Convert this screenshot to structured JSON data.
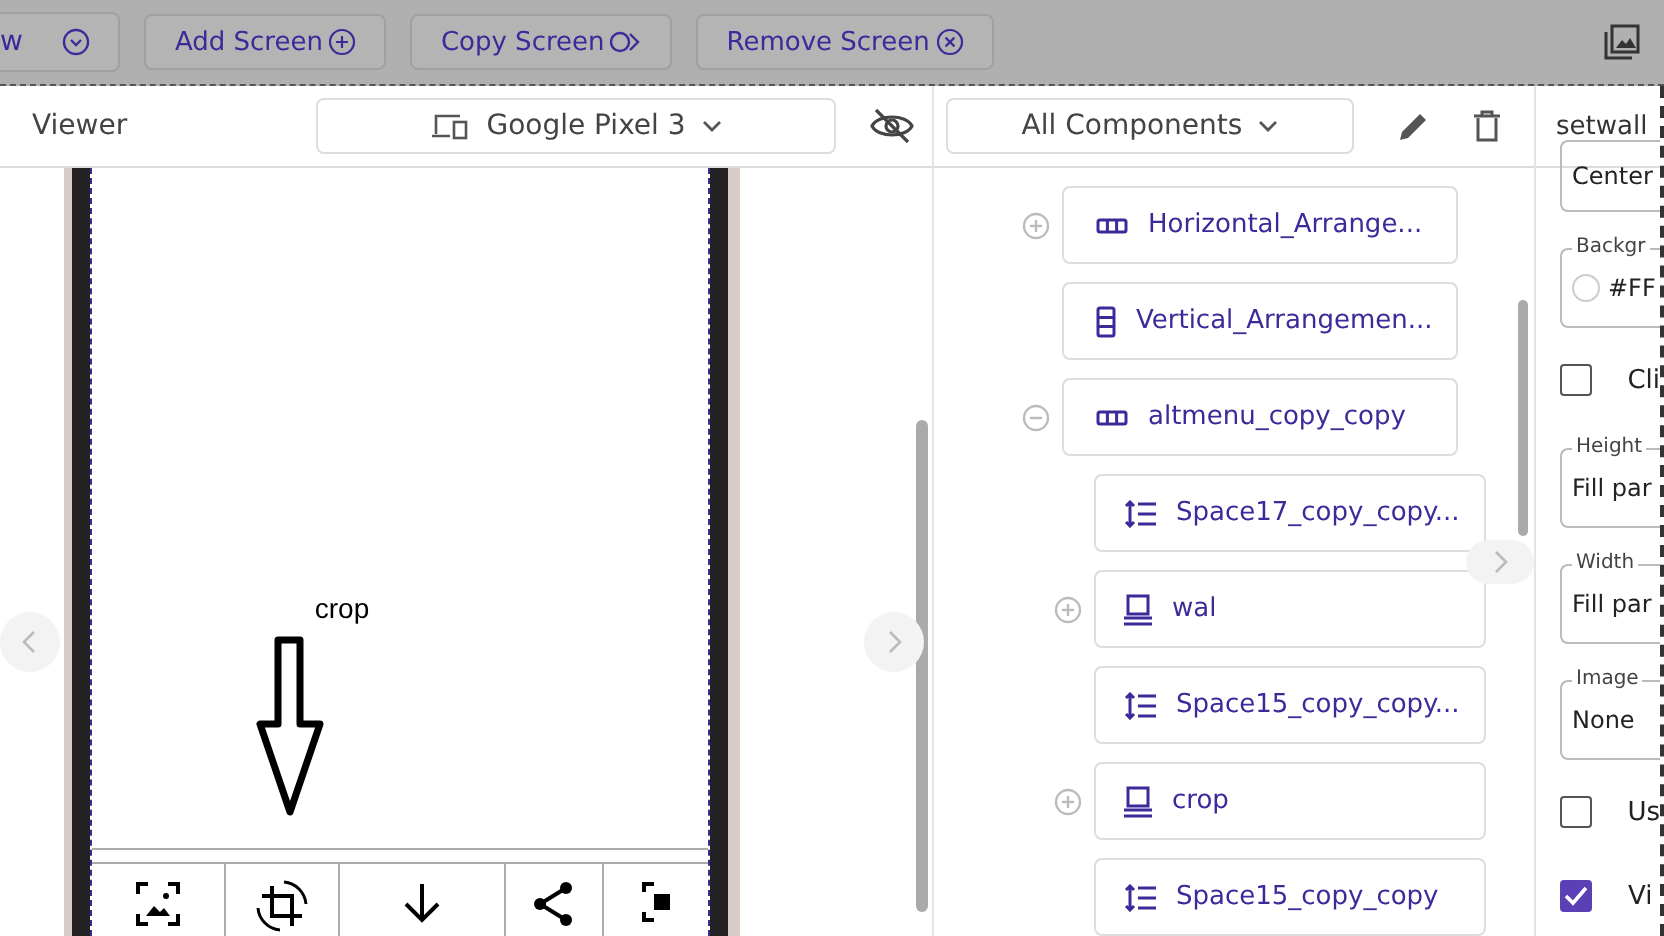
{
  "toolbar": {
    "cut_label": "w",
    "buttons": [
      {
        "label": "Add Screen",
        "kind": "add"
      },
      {
        "label": "Copy Screen",
        "kind": "copy"
      },
      {
        "label": "Remove Screen",
        "kind": "remove"
      }
    ]
  },
  "viewer": {
    "title": "Viewer",
    "device": "Google Pixel 3",
    "screen_text": "crop"
  },
  "components": {
    "filter": "All Components",
    "tree": [
      {
        "label": "Horizontal_Arrange...",
        "kind": "horizontal",
        "expanded": false
      },
      {
        "label": "Vertical_Arrangemen...",
        "kind": "vertical"
      },
      {
        "label": "altmenu_copy_copy",
        "kind": "horizontal",
        "expanded": true,
        "children": [
          {
            "label": "Space17_copy_copy...",
            "kind": "space"
          },
          {
            "label": "wal",
            "kind": "image",
            "expanded": false
          },
          {
            "label": "Space15_copy_copy...",
            "kind": "space"
          },
          {
            "label": "crop",
            "kind": "image",
            "expanded": false
          },
          {
            "label": "Space15_copy_copy",
            "kind": "space"
          }
        ]
      }
    ]
  },
  "properties": {
    "title": "setwall",
    "items": [
      {
        "kind": "value",
        "value": "Center"
      },
      {
        "kind": "color",
        "legend": "Backgr",
        "value": "#FF"
      },
      {
        "kind": "check",
        "label": "Cli",
        "checked": false
      },
      {
        "kind": "field",
        "legend": "Height",
        "value": "Fill par"
      },
      {
        "kind": "field",
        "legend": "Width",
        "value": "Fill par"
      },
      {
        "kind": "field",
        "legend": "Image",
        "value": "None"
      },
      {
        "kind": "check",
        "label": "Us",
        "checked": false
      },
      {
        "kind": "check",
        "label": "Vi",
        "checked": true
      }
    ]
  }
}
